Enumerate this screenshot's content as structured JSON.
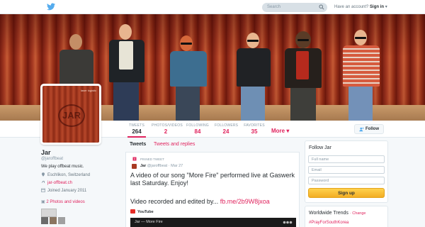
{
  "topbar": {
    "search_placeholder": "Search",
    "account_prompt": "Have an account?",
    "signin_label": "Sign in"
  },
  "profile": {
    "avatar_corner_text": "laser logistic",
    "avatar_logo_text": "JAR",
    "name": "Jar",
    "handle": "@jaroffbeat",
    "bio": "We play offbeat music.",
    "location": "Eschlikon, Switzerland",
    "website": "jar-offbeat.ch",
    "joined": "Joined January 2011",
    "photos_link": "2 Photos and videos"
  },
  "stats": [
    {
      "label": "TWEETS",
      "value": "264"
    },
    {
      "label": "PHOTOS/VIDEOS",
      "value": "2"
    },
    {
      "label": "FOLLOWING",
      "value": "84"
    },
    {
      "label": "FOLLOWERS",
      "value": "24"
    },
    {
      "label": "FAVORITES",
      "value": "35"
    }
  ],
  "more_label": "More",
  "follow_button": "Follow",
  "timeline_tabs": [
    "Tweets",
    "Tweets and replies"
  ],
  "tweet": {
    "pinned_label": "PINNED TWEET",
    "author": "Jar",
    "handle": "@jaroffbeat",
    "date": "· Mar 27",
    "text": "A video of our song \"More Fire\" performed live at Gaswerk last Saturday. Enjoy!",
    "text2_prefix": "Video recorded and edited by...",
    "text2_link": "fb.me/2b9W8jxoa",
    "media_source": "YouTube",
    "video_title": "Jar — More Fire"
  },
  "follow_box": {
    "title": "Follow Jar",
    "full_name_placeholder": "Full name",
    "email_placeholder": "Email",
    "password_placeholder": "Password",
    "signup_label": "Sign up"
  },
  "trends": {
    "title": "Worldwide Trends",
    "change_label": "· Change",
    "items": [
      "#PrayForSouthKorea"
    ]
  },
  "colors": {
    "accent": "#e0245e",
    "twitter_blue": "#55acee",
    "signup_yellow": "#f2ad24"
  }
}
